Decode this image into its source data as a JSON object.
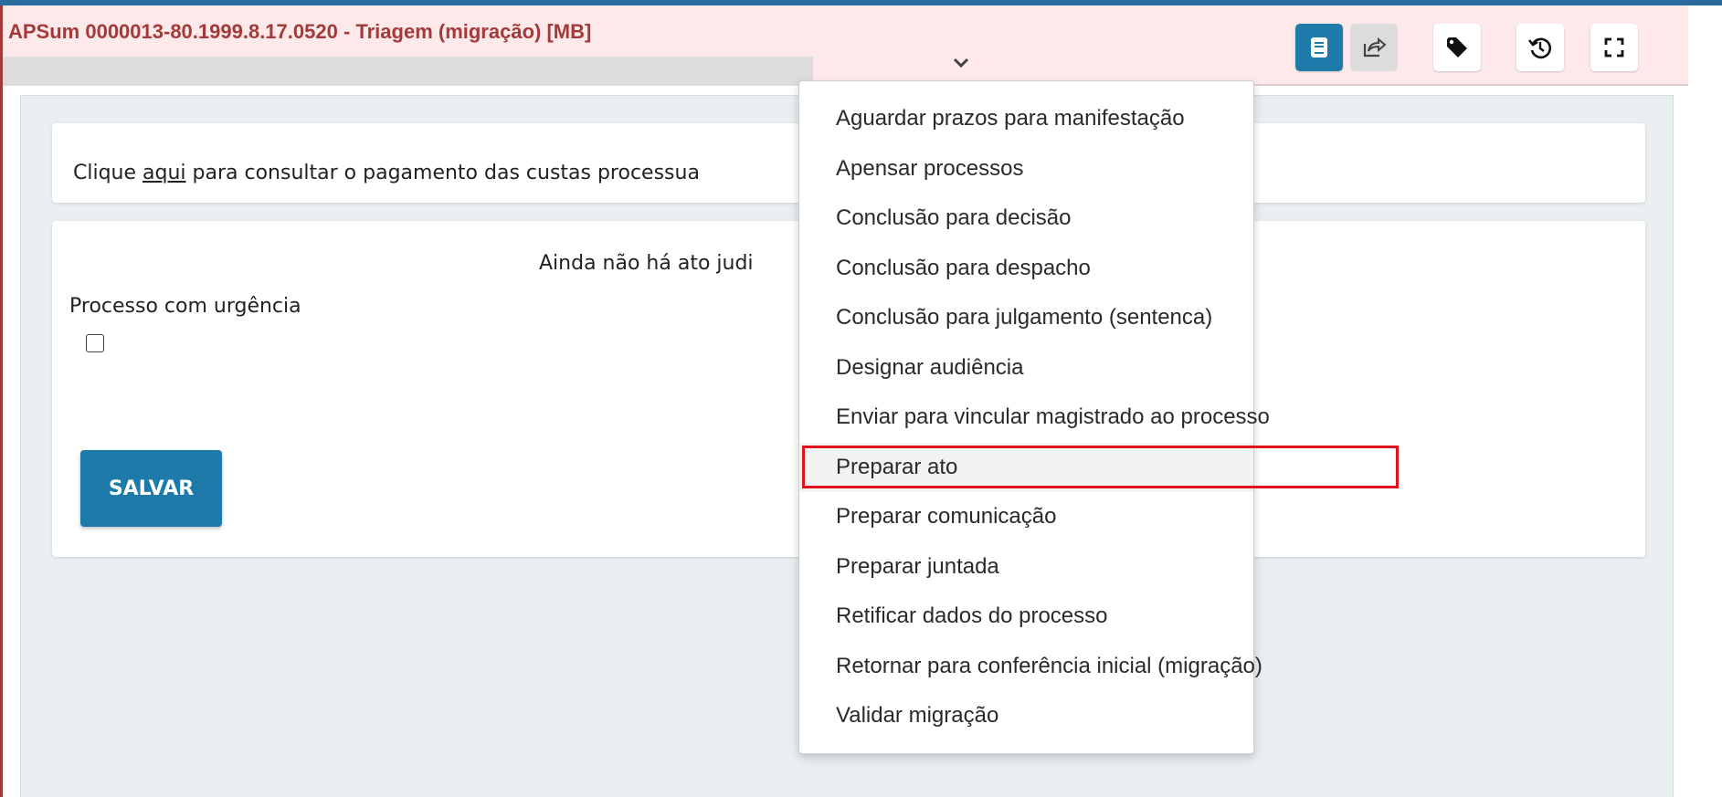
{
  "header": {
    "title": "APSum 0000013-80.1999.8.17.0520 - Triagem (migração) [MB]",
    "icons": [
      "document-icon",
      "share-icon",
      "tag-icon",
      "history-icon",
      "fullscreen-icon"
    ]
  },
  "info_card": {
    "prefix": "Clique ",
    "link": "aqui",
    "suffix": " para consultar o pagamento das custas processua"
  },
  "main_card": {
    "notice": "Ainda não há ato judi",
    "urgency_label": "Processo com urgência",
    "urgency_checked": false,
    "save_label": "SALVAR"
  },
  "menu": {
    "items": [
      "Aguardar prazos para manifestação",
      "Apensar processos",
      "Conclusão para decisão",
      "Conclusão para despacho",
      "Conclusão para julgamento (sentenca)",
      "Designar audiência",
      "Enviar para vincular magistrado ao processo",
      "Preparar ato",
      "Preparar comunicação",
      "Preparar juntada",
      "Retificar dados do processo",
      "Retornar para conferência inicial (migração)",
      "Validar migração"
    ],
    "highlighted": "Preparar ato"
  },
  "colors": {
    "title": "#a33a3a",
    "header_bg": "#fde9e9",
    "primary_button": "#1e7aa8",
    "highlight_border": "#e0121b"
  }
}
